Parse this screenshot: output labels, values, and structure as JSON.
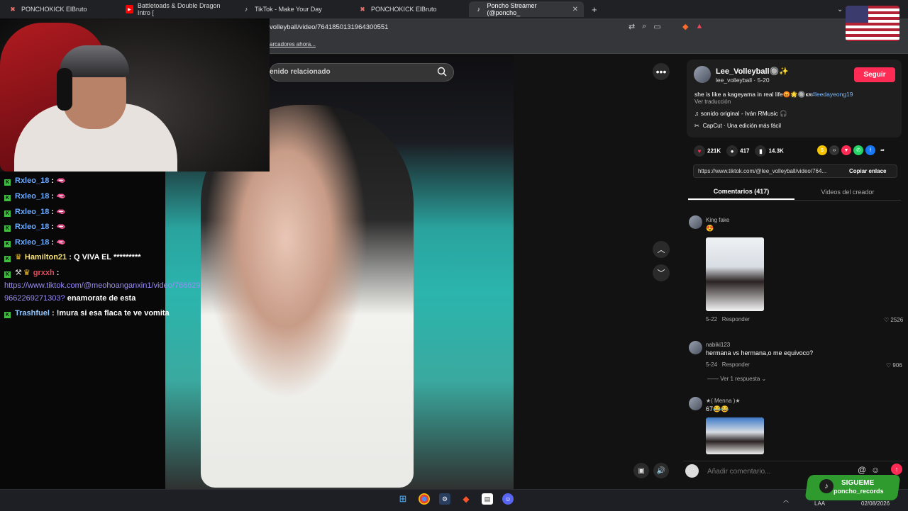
{
  "browser": {
    "tabs": [
      {
        "label": "PONCHOKICK ElBruto",
        "icon": "kick-icon",
        "color": "#e8716a"
      },
      {
        "label": "Battletoads & Double Dragon Intro [",
        "icon": "youtube-icon",
        "color": "#ff0000"
      },
      {
        "label": "TikTok - Make Your Day",
        "icon": "tiktok-icon",
        "color": "#ffffff"
      },
      {
        "label": "PONCHOKICK ElBruto",
        "icon": "kick-icon",
        "color": "#e8716a"
      },
      {
        "label": "Poncho Streamer (@poncho_",
        "icon": "tiktok-icon",
        "color": "#ffffff"
      }
    ],
    "new_tab": "+",
    "url": "volleyball/video/7641850131964300551",
    "bookmarks_text": "arcadores ahora..."
  },
  "tiktok": {
    "search_placeholder": "enido relacionado",
    "creator": {
      "name": "Lee_Volleyball🔘✨",
      "handle": "lee_volleyball · 5-20",
      "follow_label": "Seguir"
    },
    "description": "she is like a kageyama in real life😡🌟🔘ᴋʀ",
    "hashtag": "#leedayeong19",
    "see_translation": "Ver traducción",
    "music": "♫  sonido original - Iván RMusic 🎧",
    "capcut": "CapCut · Una edición más fácil",
    "stats": {
      "likes": "221K",
      "comments": "417",
      "saves": "14.3K"
    },
    "link_url": "https://www.tiktok.com/@lee_volleyball/video/764...",
    "copy_link_label": "Copiar enlace",
    "tabs": {
      "comments": "Comentarios (417)",
      "creator_videos": "Videos del creador"
    },
    "comments": [
      {
        "user": "King fake",
        "text": "😍",
        "date": "5-22",
        "reply": "Responder",
        "likes": "2526"
      },
      {
        "user": "nabiki123",
        "text": "hermana vs hermana,o me equivoco?",
        "date": "5-24",
        "reply": "Responder",
        "likes": "906",
        "replies_label": "Ver 1 respuesta"
      },
      {
        "user": "★( Menna )★",
        "text": "67😂😂"
      }
    ],
    "comment_placeholder": "Añadir comentario..."
  },
  "chat": {
    "messages": [
      {
        "user": "Rxleo_18",
        "text": "🫦"
      },
      {
        "user": "Rxleo_18",
        "text": "🫦"
      },
      {
        "user": "Rxleo_18",
        "text": "🫦"
      },
      {
        "user": "Rxleo_18",
        "text": "🫦"
      },
      {
        "user": "Rxleo_18",
        "text": "🫦"
      },
      {
        "user": "Hamilton21",
        "text": "Q VIVA EL *********"
      },
      {
        "user": "grxxh",
        "text": "",
        "link": "https://www.tiktok.com/@meohoanganxin1/video/766629",
        "link2": "9662269271303?",
        "text2": "enamorate de esta"
      },
      {
        "user": "Trashfuel",
        "text": "!mura si esa flaca te ve vomita"
      }
    ]
  },
  "overlay": {
    "sigueme": "SIGUEME",
    "handle": "poncho_records"
  },
  "taskbar": {
    "lang": "LAA",
    "date": "02/08/2026"
  }
}
